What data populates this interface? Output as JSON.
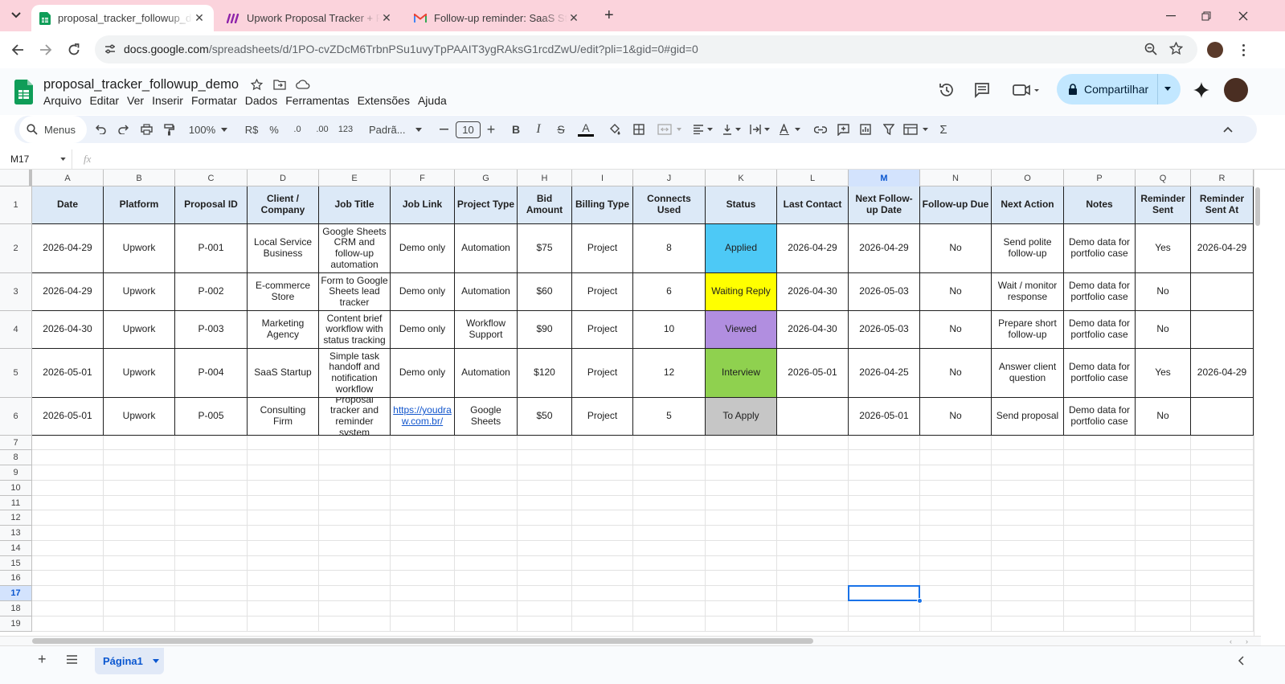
{
  "browser": {
    "tabs": [
      {
        "title": "proposal_tracker_followup_demo",
        "icon": "sheets-icon",
        "active": true
      },
      {
        "title": "Upwork Proposal Tracker + Follow-up",
        "icon": "make-icon",
        "active": false
      },
      {
        "title": "Follow-up reminder: SaaS Startup",
        "icon": "gmail-icon",
        "active": false
      }
    ],
    "url_host": "docs.google.com",
    "url_path": "/spreadsheets/d/1PO-cvZDcM6TrbnPSu1uvyTpPAAIT3ygRAksG1rcdZwU/edit?pli=1&gid=0#gid=0"
  },
  "sheets": {
    "doc_title": "proposal_tracker_followup_demo",
    "menu": [
      "Arquivo",
      "Editar",
      "Ver",
      "Inserir",
      "Formatar",
      "Dados",
      "Ferramentas",
      "Extensões",
      "Ajuda"
    ],
    "share_label": "Compartilhar",
    "toolbar": {
      "search": "Menus",
      "zoom": "100%",
      "currency": "R$",
      "percent": "%",
      "dec_decrease": ".0",
      "dec_increase": ".00",
      "number_format": "123",
      "font": "Padrã...",
      "font_size": "10"
    },
    "name_box": "M17",
    "fx": "fx",
    "sheet_tab": "Página1",
    "columns": [
      "A",
      "B",
      "C",
      "D",
      "E",
      "F",
      "G",
      "H",
      "I",
      "J",
      "K",
      "L",
      "M",
      "N",
      "O",
      "P",
      "Q",
      "R"
    ],
    "selected_column": "M",
    "selected_row": "17",
    "row_numbers": [
      "1",
      "2",
      "3",
      "4",
      "5",
      "6",
      "7",
      "8",
      "9",
      "10",
      "11",
      "12",
      "13",
      "14",
      "15",
      "16",
      "17",
      "18",
      "19"
    ],
    "headers": [
      "Date",
      "Platform",
      "Proposal ID",
      "Client / Company",
      "Job Title",
      "Job Link",
      "Project Type",
      "Bid Amount",
      "Billing Type",
      "Connects Used",
      "Status",
      "Last Contact",
      "Next Follow-up Date",
      "Follow-up Due",
      "Next Action",
      "Notes",
      "Reminder Sent",
      "Reminder Sent At"
    ],
    "rows": [
      [
        "2026-04-29",
        "Upwork",
        "P-001",
        "Local Service Business",
        "Google Sheets CRM and follow-up automation",
        "Demo only",
        "Automation",
        "$75",
        "Project",
        "8",
        "Applied",
        "2026-04-29",
        "2026-04-29",
        "No",
        "Send polite follow-up",
        "Demo data for portfolio case",
        "Yes",
        "2026-04-29"
      ],
      [
        "2026-04-29",
        "Upwork",
        "P-002",
        "E-commerce Store",
        "Form to Google Sheets lead tracker",
        "Demo only",
        "Automation",
        "$60",
        "Project",
        "6",
        "Waiting Reply",
        "2026-04-30",
        "2026-05-03",
        "No",
        "Wait / monitor response",
        "Demo data for portfolio case",
        "No",
        ""
      ],
      [
        "2026-04-30",
        "Upwork",
        "P-003",
        "Marketing Agency",
        "Content brief workflow with status tracking",
        "Demo only",
        "Workflow Support",
        "$90",
        "Project",
        "10",
        "Viewed",
        "2026-04-30",
        "2026-05-03",
        "No",
        "Prepare short follow-up",
        "Demo data for portfolio case",
        "No",
        ""
      ],
      [
        "2026-05-01",
        "Upwork",
        "P-004",
        "SaaS Startup",
        "Simple task handoff and notification workflow",
        "Demo only",
        "Automation",
        "$120",
        "Project",
        "12",
        "Interview",
        "2026-05-01",
        "2026-04-25",
        "No",
        "Answer client question",
        "Demo data for portfolio case",
        "Yes",
        "2026-04-29"
      ],
      [
        "2026-05-01",
        "Upwork",
        "P-005",
        "Consulting Firm",
        "Proposal tracker and reminder system",
        "https://youdraw.com.br/",
        "Google Sheets",
        "$50",
        "Project",
        "5",
        "To Apply",
        "",
        "2026-05-01",
        "No",
        "Send proposal",
        "Demo data for portfolio case",
        "No",
        ""
      ]
    ],
    "status_colors": {
      "Applied": "#4dc9f6",
      "Waiting Reply": "#ffff00",
      "Viewed": "#b18ee0",
      "Interview": "#8fd14f",
      "To Apply": "#c6c6c6"
    }
  }
}
